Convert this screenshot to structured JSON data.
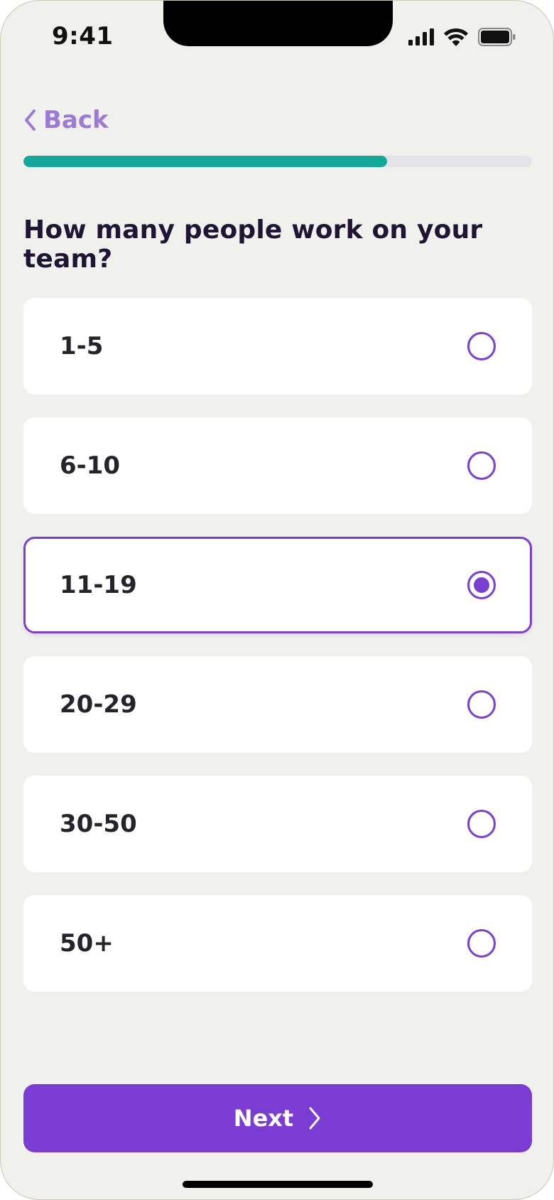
{
  "status_bar": {
    "time": "9:41",
    "icons": [
      "cellular-signal-icon",
      "wifi-icon",
      "battery-icon"
    ]
  },
  "nav": {
    "back_label": "Back",
    "back_icon": "chevron-left-icon"
  },
  "progress": {
    "value": 0.715
  },
  "question": "How many people work on your team?",
  "options": [
    {
      "label": "1-5",
      "selected": false
    },
    {
      "label": "6-10",
      "selected": false
    },
    {
      "label": "11-19",
      "selected": true
    },
    {
      "label": "20-29",
      "selected": false
    },
    {
      "label": "30-50",
      "selected": false
    },
    {
      "label": "50+",
      "selected": false
    }
  ],
  "next_button": {
    "label": "Next",
    "icon": "chevron-right-icon"
  },
  "colors": {
    "accent": "#7b3cd4",
    "progress": "#13a89a",
    "back_link": "#9d7ad6",
    "background": "#f0f1ec"
  }
}
